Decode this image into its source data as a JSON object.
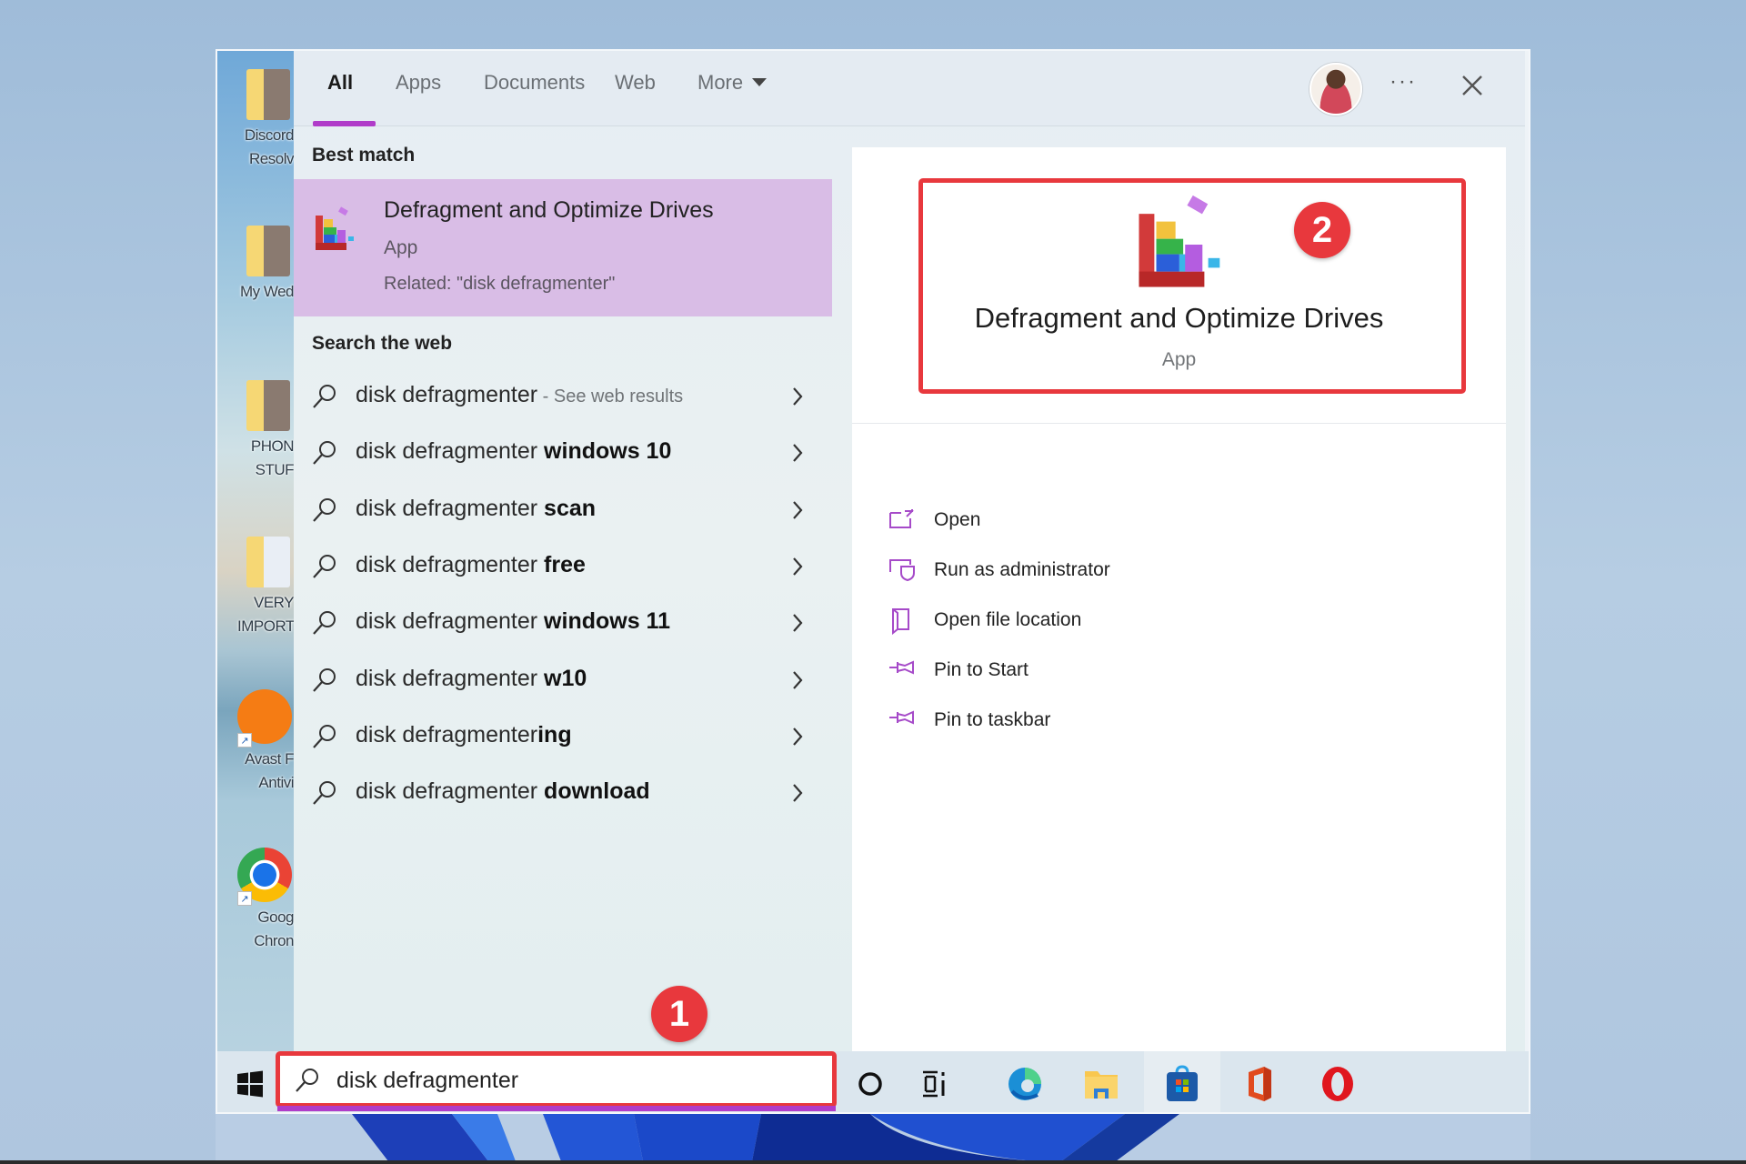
{
  "desktop": {
    "icons": [
      {
        "label": "Discord\nResolv",
        "kind": "folder"
      },
      {
        "label": "My Wed",
        "kind": "folder"
      },
      {
        "label": "PHON\nSTUF",
        "kind": "folder"
      },
      {
        "label": "VERY\nIMPORT",
        "kind": "folder"
      },
      {
        "label": "Avast F\nAntivi",
        "kind": "app",
        "icon": "avast-icon"
      },
      {
        "label": "Goog\nChron",
        "kind": "app",
        "icon": "chrome-icon"
      }
    ]
  },
  "header": {
    "tabs": [
      {
        "label": "All",
        "active": true
      },
      {
        "label": "Apps",
        "active": false
      },
      {
        "label": "Documents",
        "active": false
      },
      {
        "label": "Web",
        "active": false
      },
      {
        "label": "More",
        "active": false,
        "has_dropdown": true
      }
    ],
    "more_options_label": "···",
    "close_label": "Close"
  },
  "best_match": {
    "section_title": "Best match",
    "title": "Defragment and Optimize Drives",
    "type": "App",
    "related": "Related: \"disk defragmenter\""
  },
  "web_search": {
    "section_title": "Search the web",
    "items": [
      {
        "query": "disk defragmenter",
        "bold": "",
        "suffix": " - See web results"
      },
      {
        "query": "disk defragmenter ",
        "bold": "windows 10",
        "suffix": ""
      },
      {
        "query": "disk defragmenter ",
        "bold": "scan",
        "suffix": ""
      },
      {
        "query": "disk defragmenter ",
        "bold": "free",
        "suffix": ""
      },
      {
        "query": "disk defragmenter ",
        "bold": "windows 11",
        "suffix": ""
      },
      {
        "query": "disk defragmenter ",
        "bold": "w10",
        "suffix": ""
      },
      {
        "query": "disk defragmenter",
        "bold": "ing",
        "suffix": ""
      },
      {
        "query": "disk defragmenter ",
        "bold": "download",
        "suffix": ""
      }
    ]
  },
  "preview": {
    "title": "Defragment and Optimize Drives",
    "type": "App",
    "actions": [
      {
        "label": "Open",
        "icon": "open-icon"
      },
      {
        "label": "Run as administrator",
        "icon": "run-as-admin-icon"
      },
      {
        "label": "Open file location",
        "icon": "file-location-icon"
      },
      {
        "label": "Pin to Start",
        "icon": "pin-icon"
      },
      {
        "label": "Pin to taskbar",
        "icon": "pin-icon"
      }
    ]
  },
  "annotations": {
    "badge_1": "1",
    "badge_2": "2",
    "callout_color": "#e8383d"
  },
  "taskbar": {
    "search_value": "disk defragmenter",
    "apps": [
      "cortana",
      "task-view",
      "edge",
      "file-explorer",
      "microsoft-store",
      "office",
      "opera"
    ]
  },
  "colors": {
    "accent": "#b03cc9",
    "best_match_bg": "#d9bde6"
  }
}
